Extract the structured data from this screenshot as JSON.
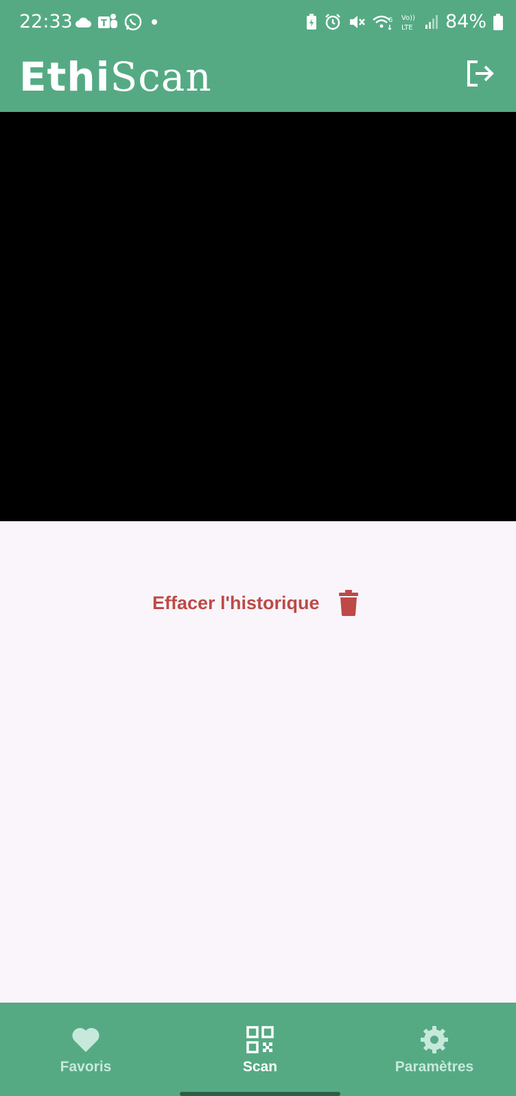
{
  "status_bar": {
    "time": "22:33",
    "battery": "84%",
    "left_icons": [
      "cloud-icon",
      "teams-icon",
      "whatsapp-icon",
      "dot-icon"
    ],
    "right_icons": [
      "battery-saver-icon",
      "alarm-icon",
      "mute-icon",
      "wifi-6-icon",
      "volte-lte-icon",
      "signal-icon",
      "battery-icon"
    ]
  },
  "app_bar": {
    "title_bold": "Ethi",
    "title_light": "Scan",
    "action_icon": "logout-icon"
  },
  "camera_preview": {
    "state": "dark"
  },
  "history": {
    "clear_label": "Effacer l'historique",
    "clear_icon": "trash-icon"
  },
  "bottom_nav": {
    "items": [
      {
        "label": "Favoris",
        "icon": "heart-icon",
        "active": false
      },
      {
        "label": "Scan",
        "icon": "qr-code-icon",
        "active": true
      },
      {
        "label": "Paramètres",
        "icon": "gear-icon",
        "active": false
      }
    ]
  },
  "colors": {
    "primary": "#55aa84",
    "background": "#f9f5fb",
    "danger": "#bd4a47",
    "nav_inactive": "#c6e9db",
    "nav_active": "#ffffff"
  }
}
